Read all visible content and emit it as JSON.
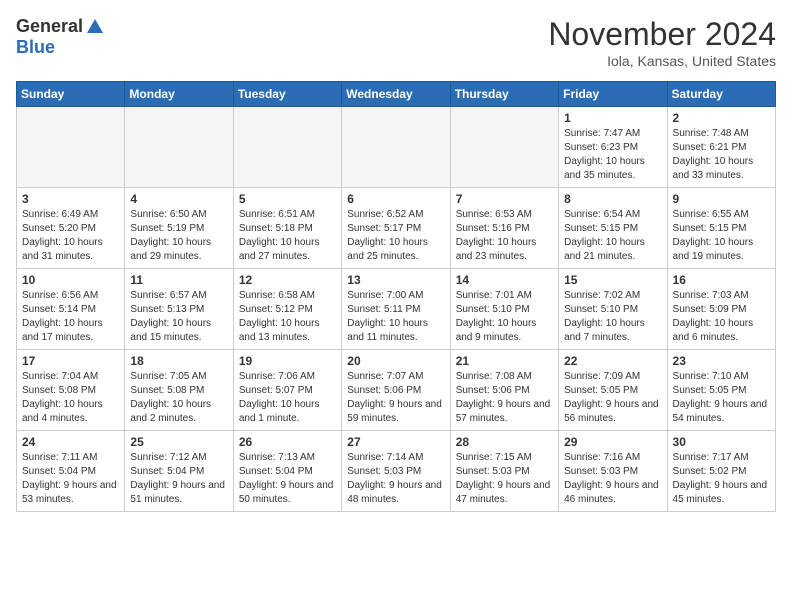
{
  "header": {
    "logo_general": "General",
    "logo_blue": "Blue",
    "month_title": "November 2024",
    "location": "Iola, Kansas, United States"
  },
  "days_of_week": [
    "Sunday",
    "Monday",
    "Tuesday",
    "Wednesday",
    "Thursday",
    "Friday",
    "Saturday"
  ],
  "weeks": [
    [
      {
        "day": "",
        "empty": true
      },
      {
        "day": "",
        "empty": true
      },
      {
        "day": "",
        "empty": true
      },
      {
        "day": "",
        "empty": true
      },
      {
        "day": "",
        "empty": true
      },
      {
        "day": "1",
        "sunrise": "7:47 AM",
        "sunset": "6:23 PM",
        "daylight": "10 hours and 35 minutes."
      },
      {
        "day": "2",
        "sunrise": "7:48 AM",
        "sunset": "6:21 PM",
        "daylight": "10 hours and 33 minutes."
      }
    ],
    [
      {
        "day": "3",
        "sunrise": "6:49 AM",
        "sunset": "5:20 PM",
        "daylight": "10 hours and 31 minutes."
      },
      {
        "day": "4",
        "sunrise": "6:50 AM",
        "sunset": "5:19 PM",
        "daylight": "10 hours and 29 minutes."
      },
      {
        "day": "5",
        "sunrise": "6:51 AM",
        "sunset": "5:18 PM",
        "daylight": "10 hours and 27 minutes."
      },
      {
        "day": "6",
        "sunrise": "6:52 AM",
        "sunset": "5:17 PM",
        "daylight": "10 hours and 25 minutes."
      },
      {
        "day": "7",
        "sunrise": "6:53 AM",
        "sunset": "5:16 PM",
        "daylight": "10 hours and 23 minutes."
      },
      {
        "day": "8",
        "sunrise": "6:54 AM",
        "sunset": "5:15 PM",
        "daylight": "10 hours and 21 minutes."
      },
      {
        "day": "9",
        "sunrise": "6:55 AM",
        "sunset": "5:15 PM",
        "daylight": "10 hours and 19 minutes."
      }
    ],
    [
      {
        "day": "10",
        "sunrise": "6:56 AM",
        "sunset": "5:14 PM",
        "daylight": "10 hours and 17 minutes."
      },
      {
        "day": "11",
        "sunrise": "6:57 AM",
        "sunset": "5:13 PM",
        "daylight": "10 hours and 15 minutes."
      },
      {
        "day": "12",
        "sunrise": "6:58 AM",
        "sunset": "5:12 PM",
        "daylight": "10 hours and 13 minutes."
      },
      {
        "day": "13",
        "sunrise": "7:00 AM",
        "sunset": "5:11 PM",
        "daylight": "10 hours and 11 minutes."
      },
      {
        "day": "14",
        "sunrise": "7:01 AM",
        "sunset": "5:10 PM",
        "daylight": "10 hours and 9 minutes."
      },
      {
        "day": "15",
        "sunrise": "7:02 AM",
        "sunset": "5:10 PM",
        "daylight": "10 hours and 7 minutes."
      },
      {
        "day": "16",
        "sunrise": "7:03 AM",
        "sunset": "5:09 PM",
        "daylight": "10 hours and 6 minutes."
      }
    ],
    [
      {
        "day": "17",
        "sunrise": "7:04 AM",
        "sunset": "5:08 PM",
        "daylight": "10 hours and 4 minutes."
      },
      {
        "day": "18",
        "sunrise": "7:05 AM",
        "sunset": "5:08 PM",
        "daylight": "10 hours and 2 minutes."
      },
      {
        "day": "19",
        "sunrise": "7:06 AM",
        "sunset": "5:07 PM",
        "daylight": "10 hours and 1 minute."
      },
      {
        "day": "20",
        "sunrise": "7:07 AM",
        "sunset": "5:06 PM",
        "daylight": "9 hours and 59 minutes."
      },
      {
        "day": "21",
        "sunrise": "7:08 AM",
        "sunset": "5:06 PM",
        "daylight": "9 hours and 57 minutes."
      },
      {
        "day": "22",
        "sunrise": "7:09 AM",
        "sunset": "5:05 PM",
        "daylight": "9 hours and 56 minutes."
      },
      {
        "day": "23",
        "sunrise": "7:10 AM",
        "sunset": "5:05 PM",
        "daylight": "9 hours and 54 minutes."
      }
    ],
    [
      {
        "day": "24",
        "sunrise": "7:11 AM",
        "sunset": "5:04 PM",
        "daylight": "9 hours and 53 minutes."
      },
      {
        "day": "25",
        "sunrise": "7:12 AM",
        "sunset": "5:04 PM",
        "daylight": "9 hours and 51 minutes."
      },
      {
        "day": "26",
        "sunrise": "7:13 AM",
        "sunset": "5:04 PM",
        "daylight": "9 hours and 50 minutes."
      },
      {
        "day": "27",
        "sunrise": "7:14 AM",
        "sunset": "5:03 PM",
        "daylight": "9 hours and 48 minutes."
      },
      {
        "day": "28",
        "sunrise": "7:15 AM",
        "sunset": "5:03 PM",
        "daylight": "9 hours and 47 minutes."
      },
      {
        "day": "29",
        "sunrise": "7:16 AM",
        "sunset": "5:03 PM",
        "daylight": "9 hours and 46 minutes."
      },
      {
        "day": "30",
        "sunrise": "7:17 AM",
        "sunset": "5:02 PM",
        "daylight": "9 hours and 45 minutes."
      }
    ]
  ]
}
